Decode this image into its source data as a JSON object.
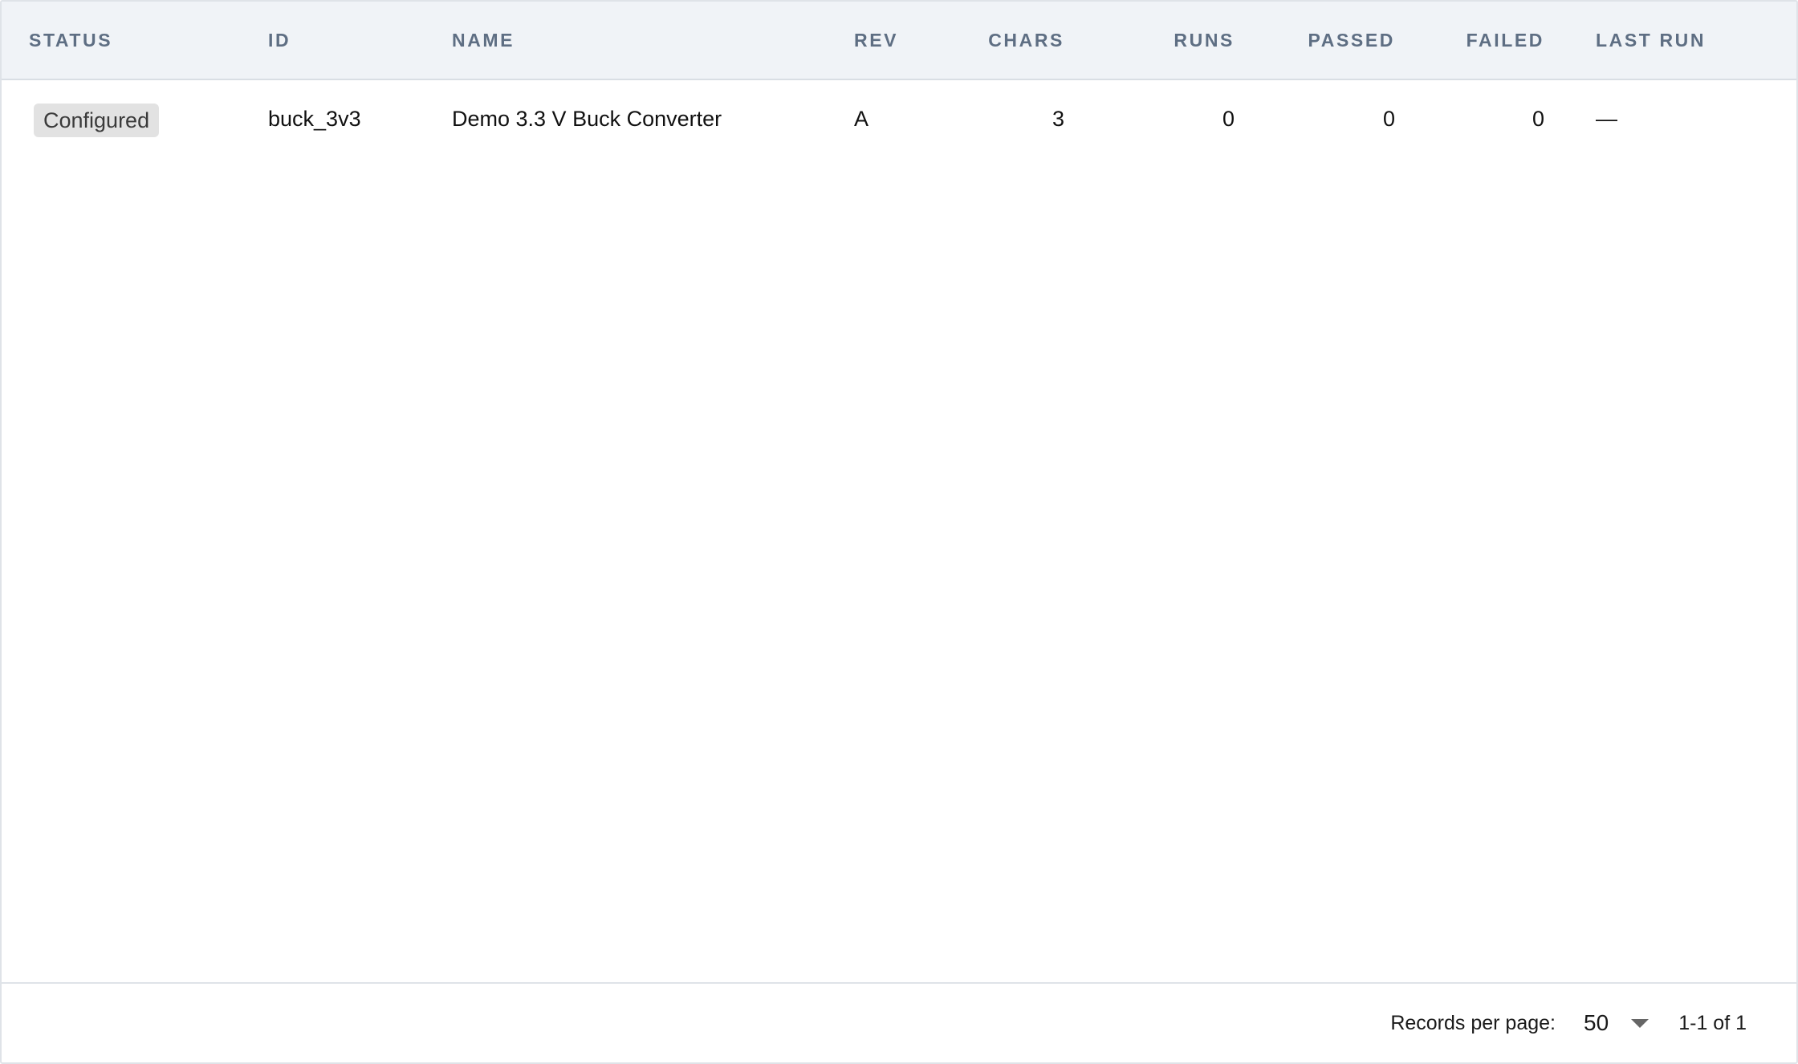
{
  "table": {
    "columns": {
      "status": "STATUS",
      "id": "ID",
      "name": "NAME",
      "rev": "REV",
      "chars": "CHARS",
      "runs": "RUNS",
      "passed": "PASSED",
      "failed": "FAILED",
      "last_run": "LAST RUN"
    },
    "rows": [
      {
        "status": "Configured",
        "id": "buck_3v3",
        "name": "Demo 3.3 V Buck Converter",
        "rev": "A",
        "chars": "3",
        "runs": "0",
        "passed": "0",
        "failed": "0",
        "last_run": "—"
      }
    ]
  },
  "pagination": {
    "records_per_page_label": "Records per page:",
    "records_per_page_value": "50",
    "range_text": "1-1 of 1",
    "dropdown_icon": "caret-down-icon"
  },
  "colors": {
    "header_bg": "#f0f3f7",
    "header_text": "#5e6e83",
    "badge_bg": "#e2e2e2",
    "border": "#dfe3e8"
  }
}
